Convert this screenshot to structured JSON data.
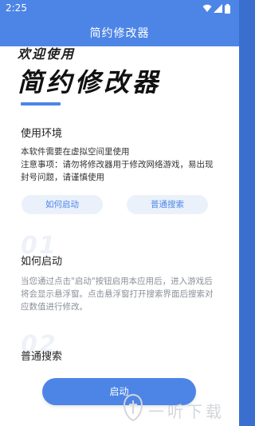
{
  "status_bar": {
    "time": "2:25"
  },
  "app_bar": {
    "title": "简约修改器"
  },
  "hero": {
    "welcome": "欢迎使用",
    "app_name": "简约修改器"
  },
  "sections": {
    "environment": {
      "title": "使用环境",
      "text": "本软件需要在虚拟空间里使用\n注意事项：请勿将修改器用于修改网络游戏，易出现封号问题，请谨慎使用",
      "buttons": [
        "如何启动",
        "普通搜索"
      ]
    },
    "how_to_start": {
      "number": "01",
      "title": "如何启动",
      "text": "当您通过点击\"启动\"按钮启用本应用后，进入游戏后将会显示悬浮窗。点击悬浮窗打开搜索界面后搜索对应数值进行修改。"
    },
    "normal_search": {
      "number": "02",
      "title": "普通搜索"
    }
  },
  "launch_button": {
    "label": "启动"
  },
  "watermark": {
    "text": "一听下载"
  },
  "colors": {
    "accent": "#4d85e6",
    "pill_bg": "#eaf1fb"
  }
}
